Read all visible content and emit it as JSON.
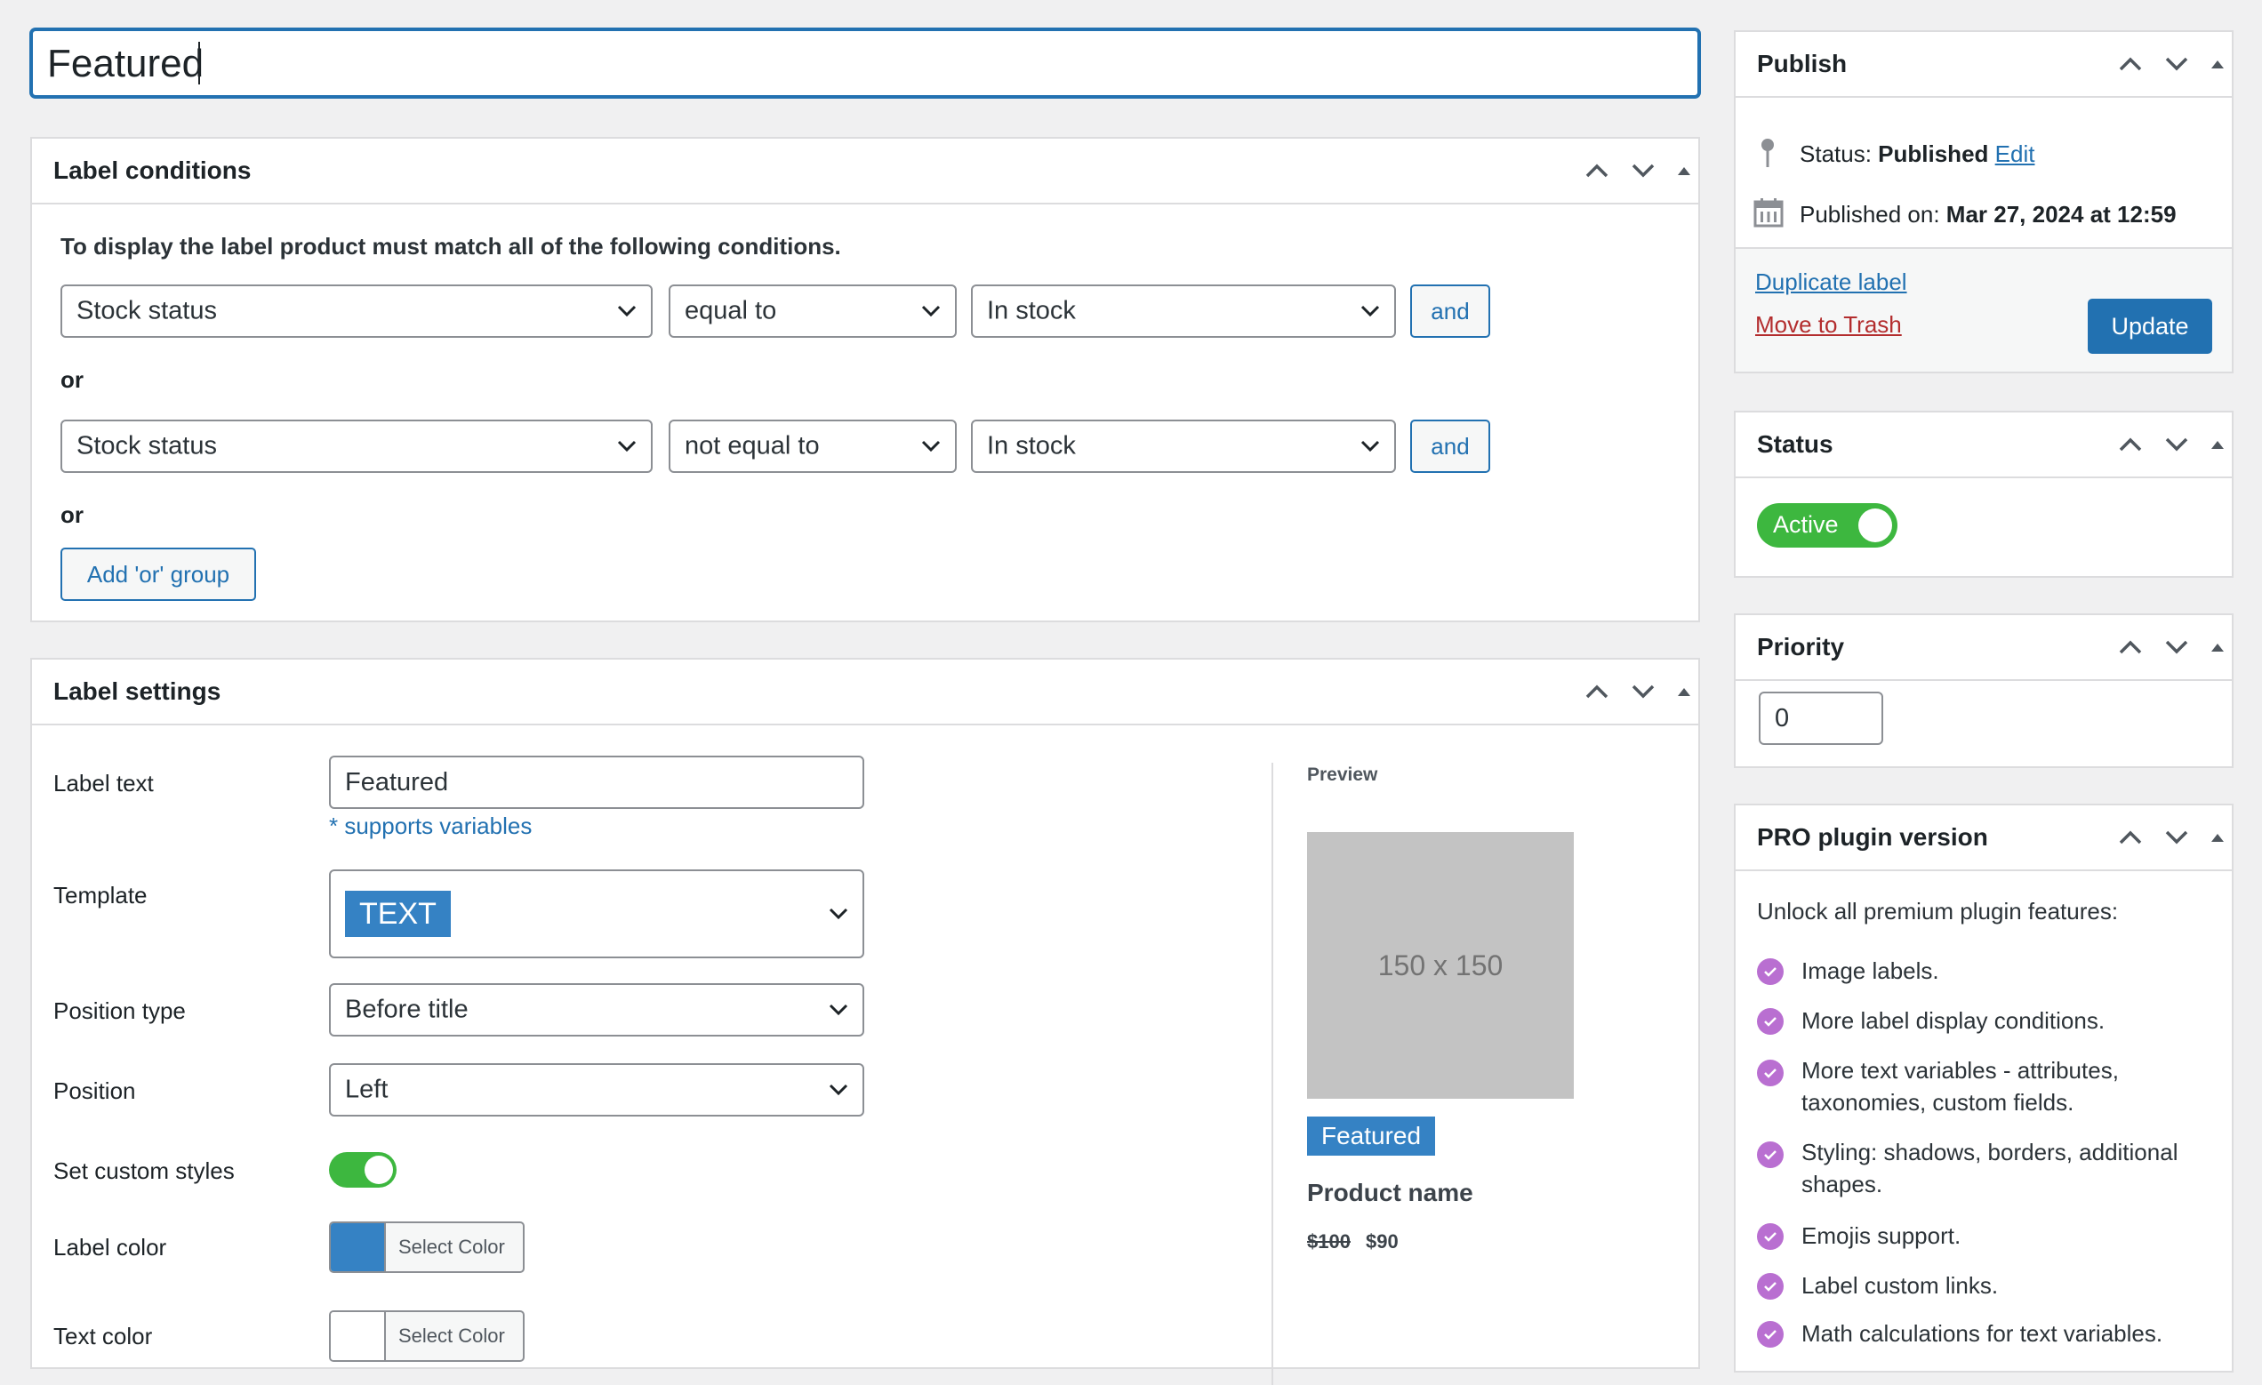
{
  "title_input": {
    "value": "Featured"
  },
  "label_conditions": {
    "title": "Label conditions",
    "intro": "To display the label product must match all of the following conditions.",
    "rows": [
      {
        "field": "Stock status",
        "operator": "equal to",
        "value": "In stock",
        "and_label": "and"
      },
      {
        "field": "Stock status",
        "operator": "not equal to",
        "value": "In stock",
        "and_label": "and"
      }
    ],
    "or_label": "or",
    "add_or_group": "Add 'or' group"
  },
  "label_settings": {
    "title": "Label settings",
    "label_text": {
      "label": "Label text",
      "value": "Featured",
      "hint": "* supports variables"
    },
    "template": {
      "label": "Template",
      "value": "TEXT"
    },
    "position_type": {
      "label": "Position type",
      "value": "Before title"
    },
    "position": {
      "label": "Position",
      "value": "Left"
    },
    "custom_styles": {
      "label": "Set custom styles",
      "enabled": true
    },
    "label_color": {
      "label": "Label color",
      "button": "Select Color",
      "color": "#3582c4"
    },
    "text_color": {
      "label": "Text color",
      "button": "Select Color",
      "color": "#ffffff"
    },
    "preview": {
      "heading": "Preview",
      "placeholder": "150 x 150",
      "badge": "Featured",
      "product_name": "Product name",
      "old_price": "$100",
      "new_price": "$90"
    }
  },
  "publish": {
    "title": "Publish",
    "status_label": "Status:",
    "status_value": "Published",
    "status_edit": "Edit",
    "published_label": "Published on:",
    "published_value": "Mar 27, 2024 at 12:59",
    "duplicate": "Duplicate label",
    "trash": "Move to Trash",
    "update": "Update"
  },
  "status_box": {
    "title": "Status",
    "toggle_label": "Active",
    "active": true
  },
  "priority_box": {
    "title": "Priority",
    "value": "0"
  },
  "pro_box": {
    "title": "PRO plugin version",
    "intro": "Unlock all premium plugin features:",
    "features": [
      "Image labels.",
      "More label display conditions.",
      "More text variables - attributes, taxonomies, custom fields.",
      "Styling: shadows, borders, additional shapes.",
      "Emojis support.",
      "Label custom links.",
      "Math calculations for text variables."
    ]
  },
  "colors": {
    "accent": "#2271b1",
    "toggle_on": "#3db73f",
    "trash": "#b32d2e",
    "pro_check": "#b96fd1",
    "template_badge": "#3582c4"
  },
  "icons": [
    "chevron-up-icon",
    "chevron-down-icon",
    "triangle-up-icon",
    "pin-icon",
    "calendar-icon",
    "check-icon"
  ]
}
